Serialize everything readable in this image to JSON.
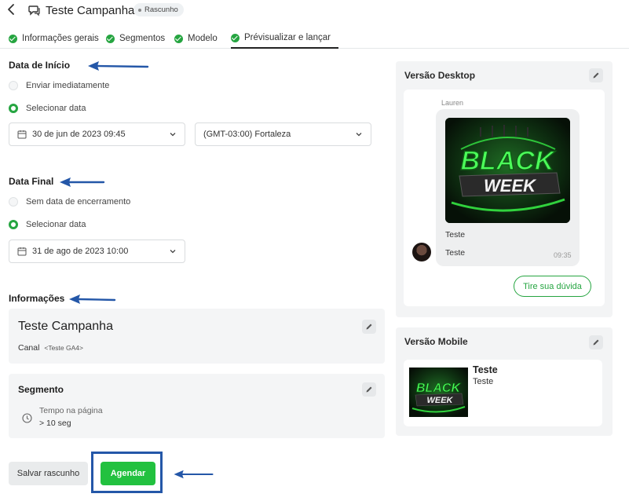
{
  "header": {
    "back_icon": "chevron-left-icon",
    "campaign_icon": "chat-icon",
    "title": "Teste Campanha",
    "status_badge": "Rascunho"
  },
  "tabs": [
    {
      "label": "Informações gerais",
      "completed": true
    },
    {
      "label": "Segmentos",
      "completed": true
    },
    {
      "label": "Modelo",
      "completed": true
    },
    {
      "label": "Prévisualizar e lançar",
      "completed": true,
      "active": true
    }
  ],
  "start": {
    "heading": "Data de Início",
    "options": [
      "Enviar imediatamente",
      "Selecionar data"
    ],
    "selected": "Selecionar data",
    "date_value": "30 de jun de 2023 09:45",
    "timezone_value": "(GMT-03:00) Fortaleza"
  },
  "end": {
    "heading": "Data Final",
    "options": [
      "Sem data de encerramento",
      "Selecionar data"
    ],
    "selected": "Selecionar data",
    "date_value": "31 de ago de 2023 10:00"
  },
  "info": {
    "heading": "Informações",
    "campaign_name": "Teste Campanha",
    "channel_label": "Canal",
    "channel_value": "<Teste GA4>",
    "segment_heading": "Segmento",
    "segment_rule_label": "Tempo na página",
    "segment_rule_value": "> 10 seg"
  },
  "actions": {
    "save_draft": "Salvar rascunho",
    "schedule": "Agendar"
  },
  "preview_desktop": {
    "title": "Versão Desktop",
    "sender": "Lauren",
    "image_text": [
      "BLACK",
      "WEEK"
    ],
    "message_title": "Teste",
    "message_body": "Teste",
    "time": "09:35",
    "cta": "Tire sua dúvida"
  },
  "preview_mobile": {
    "title": "Versão Mobile",
    "image_text": [
      "BLACK",
      "WEEK"
    ],
    "message_title": "Teste",
    "message_body": "Teste"
  },
  "colors": {
    "accent_green": "#26a541",
    "primary_button": "#22c13f",
    "annotation_blue": "#2457a8"
  }
}
